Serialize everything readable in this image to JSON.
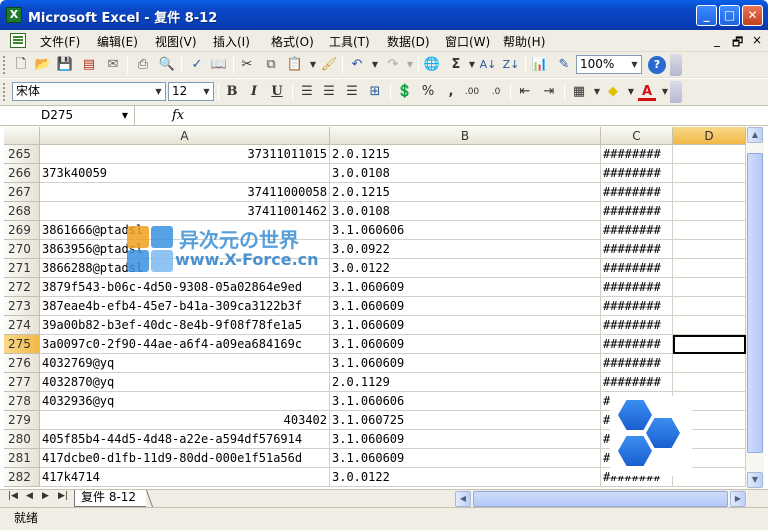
{
  "window": {
    "title": "Microsoft Excel - 复件 8-12",
    "app_icon": "X",
    "controls": [
      "_",
      "□",
      "✕"
    ]
  },
  "menu": {
    "items": [
      "文件(F)",
      "编辑(E)",
      "视图(V)",
      "插入(I)",
      "格式(O)",
      "工具(T)",
      "数据(D)",
      "窗口(W)",
      "帮助(H)"
    ],
    "doc_controls": [
      "_",
      "🗗",
      "×"
    ]
  },
  "toolbar": {
    "zoom": "100%",
    "font_name": "宋体",
    "font_size": "12",
    "bold": "B",
    "italic": "I",
    "underline": "U",
    "percent": "%",
    "comma": ","
  },
  "formula_bar": {
    "name_box": "D275",
    "fx": "fx",
    "formula": ""
  },
  "columns": [
    {
      "label": "",
      "active": false
    },
    {
      "label": "A",
      "active": false
    },
    {
      "label": "B",
      "active": false
    },
    {
      "label": "C",
      "active": false
    },
    {
      "label": "D",
      "active": true
    }
  ],
  "rows": [
    {
      "num": "265",
      "a": "37311011015",
      "a_num": true,
      "b": "2.0.1215",
      "c": "########"
    },
    {
      "num": "266",
      "a": "373k40059",
      "a_num": false,
      "b": "3.0.0108",
      "c": "########"
    },
    {
      "num": "267",
      "a": "37411000058",
      "a_num": true,
      "b": "2.0.1215",
      "c": "########"
    },
    {
      "num": "268",
      "a": "37411001462",
      "a_num": true,
      "b": "3.0.0108",
      "c": "########"
    },
    {
      "num": "269",
      "a": "3861666@ptadsl",
      "a_num": false,
      "b": "3.1.060606",
      "c": "########"
    },
    {
      "num": "270",
      "a": "3863956@ptadsl",
      "a_num": false,
      "b": "3.0.0922",
      "c": "########"
    },
    {
      "num": "271",
      "a": "3866288@ptadsl",
      "a_num": false,
      "b": "3.0.0122",
      "c": "########"
    },
    {
      "num": "272",
      "a": "3879f543-b06c-4d50-9308-05a02864e9ed",
      "a_num": false,
      "b": "3.1.060609",
      "c": "########"
    },
    {
      "num": "273",
      "a": "387eae4b-efb4-45e7-b41a-309ca3122b3f",
      "a_num": false,
      "b": "3.1.060609",
      "c": "########"
    },
    {
      "num": "274",
      "a": "39a00b82-b3ef-40dc-8e4b-9f08f78fe1a5",
      "a_num": false,
      "b": "3.1.060609",
      "c": "########"
    },
    {
      "num": "275",
      "a": "3a0097c0-2f90-44ae-a6f4-a09ea684169c",
      "a_num": false,
      "b": "3.1.060609",
      "c": "########",
      "active": true
    },
    {
      "num": "276",
      "a": "4032769@yq",
      "a_num": false,
      "b": "3.1.060609",
      "c": "########"
    },
    {
      "num": "277",
      "a": "4032870@yq",
      "a_num": false,
      "b": "2.0.1129",
      "c": "########"
    },
    {
      "num": "278",
      "a": "4032936@yq",
      "a_num": false,
      "b": "3.1.060606",
      "c": "########"
    },
    {
      "num": "279",
      "a": "403402",
      "a_num": true,
      "b": "3.1.060725",
      "c": "########"
    },
    {
      "num": "280",
      "a": "405f85b4-44d5-4d48-a22e-a594df576914",
      "a_num": false,
      "b": "3.1.060609",
      "c": "########"
    },
    {
      "num": "281",
      "a": "417dcbe0-d1fb-11d9-80dd-000e1f51a56d",
      "a_num": false,
      "b": "3.1.060609",
      "c": "########"
    },
    {
      "num": "282",
      "a": "417k4714",
      "a_num": false,
      "b": "3.0.0122",
      "c": "########"
    }
  ],
  "sheet": {
    "tab": "复件 8-12"
  },
  "status": {
    "text": "就绪"
  },
  "watermark": {
    "line1": "异次元の世界",
    "line2": "www.X-Force.cn"
  }
}
